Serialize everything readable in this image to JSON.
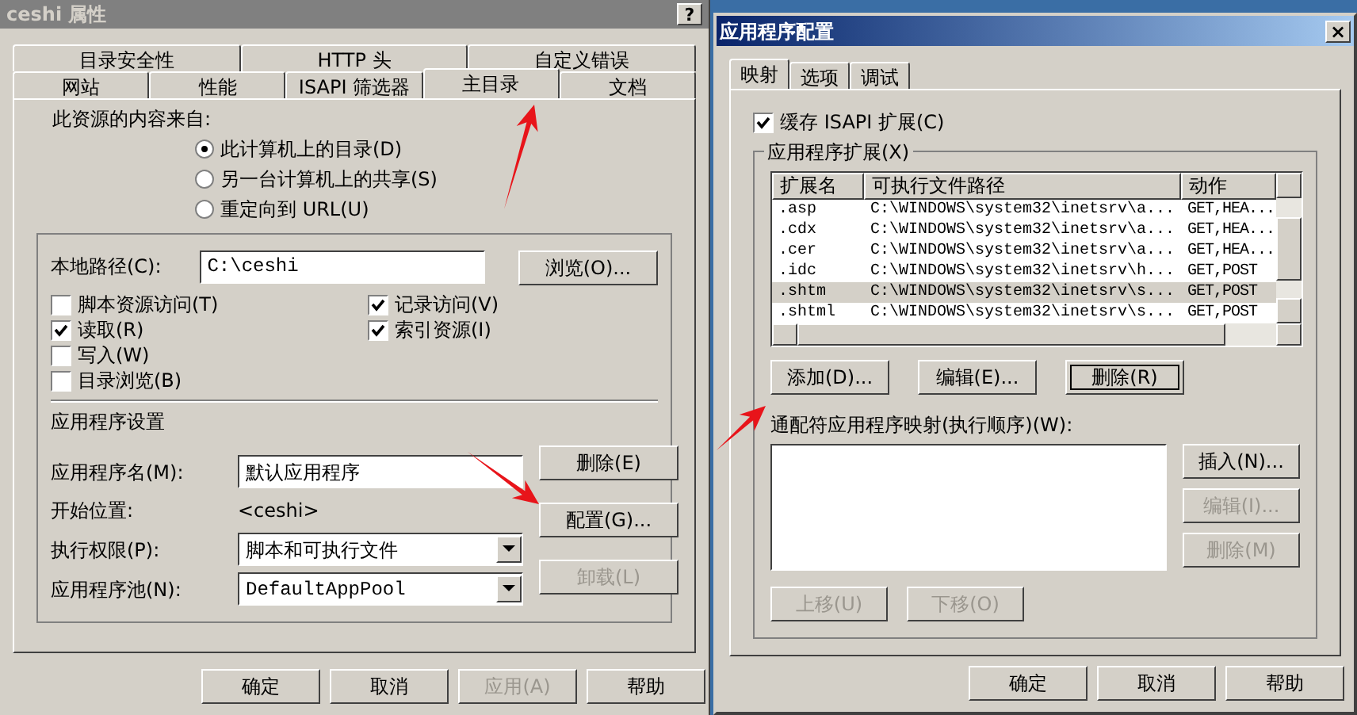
{
  "left_window": {
    "title": "ceshi 属性",
    "help_button": "?",
    "tab_rows": [
      [
        {
          "label": "目录安全性",
          "selected": false
        },
        {
          "label": "HTTP 头",
          "selected": false
        },
        {
          "label": "自定义错误",
          "selected": false
        }
      ],
      [
        {
          "label": "网站",
          "selected": false
        },
        {
          "label": "性能",
          "selected": false
        },
        {
          "label": "ISAPI 筛选器",
          "selected": false
        },
        {
          "label": "主目录",
          "selected": true
        },
        {
          "label": "文档",
          "selected": false
        }
      ]
    ],
    "content_source_label": "此资源的内容来自:",
    "source_options": [
      {
        "label": "此计算机上的目录(D)",
        "selected": true
      },
      {
        "label": "另一台计算机上的共享(S)",
        "selected": false
      },
      {
        "label": "重定向到 URL(U)",
        "selected": false
      }
    ],
    "local_path": {
      "label": "本地路径(C):",
      "value": "C:\\ceshi",
      "button": "浏览(O)..."
    },
    "permissions_left": [
      {
        "label": "脚本资源访问(T)",
        "checked": false
      },
      {
        "label": "读取(R)",
        "checked": true
      },
      {
        "label": "写入(W)",
        "checked": false
      },
      {
        "label": "目录浏览(B)",
        "checked": false
      }
    ],
    "permissions_right": [
      {
        "label": "记录访问(V)",
        "checked": true
      },
      {
        "label": "索引资源(I)",
        "checked": true
      }
    ],
    "app_settings": {
      "title": "应用程序设置",
      "name": {
        "label": "应用程序名(M):",
        "value": "默认应用程序"
      },
      "start": {
        "label": "开始位置:",
        "value": "<ceshi>"
      },
      "exec": {
        "label": "执行权限(P):",
        "value": "脚本和可执行文件"
      },
      "pool": {
        "label": "应用程序池(N):",
        "value": "DefaultAppPool"
      },
      "buttons": [
        {
          "label": "删除(E)",
          "disabled": false
        },
        {
          "label": "配置(G)...",
          "disabled": false
        },
        {
          "label": "卸载(L)",
          "disabled": true
        }
      ]
    },
    "buttons": [
      {
        "label": "确定",
        "disabled": false
      },
      {
        "label": "取消",
        "disabled": false
      },
      {
        "label": "应用(A)",
        "disabled": true
      },
      {
        "label": "帮助",
        "disabled": false
      }
    ]
  },
  "right_window": {
    "title": "应用程序配置",
    "close_button": "×",
    "tabs": [
      {
        "label": "映射",
        "selected": true
      },
      {
        "label": "选项",
        "selected": false
      },
      {
        "label": "调试",
        "selected": false
      }
    ],
    "cache_checkbox": {
      "label": "缓存 ISAPI 扩展(C)",
      "checked": true
    },
    "extensions": {
      "title": "应用程序扩展(X)",
      "columns": [
        "扩展名",
        "可执行文件路径",
        "动作"
      ],
      "rows": [
        {
          "cells": [
            ".asp",
            "C:\\WINDOWS\\system32\\inetsrv\\a...",
            "GET,HEA..."
          ],
          "selected": false
        },
        {
          "cells": [
            ".cdx",
            "C:\\WINDOWS\\system32\\inetsrv\\a...",
            "GET,HEA..."
          ],
          "selected": false
        },
        {
          "cells": [
            ".cer",
            "C:\\WINDOWS\\system32\\inetsrv\\a...",
            "GET,HEA..."
          ],
          "selected": false
        },
        {
          "cells": [
            ".idc",
            "C:\\WINDOWS\\system32\\inetsrv\\h...",
            "GET,POST"
          ],
          "selected": false
        },
        {
          "cells": [
            ".shtm",
            "C:\\WINDOWS\\system32\\inetsrv\\s...",
            "GET,POST"
          ],
          "selected": true
        },
        {
          "cells": [
            ".shtml",
            "C:\\WINDOWS\\system32\\inetsrv\\s...",
            "GET,POST"
          ],
          "selected": false
        }
      ]
    },
    "ext_buttons": [
      {
        "label": "添加(D)...",
        "disabled": false,
        "focused": false
      },
      {
        "label": "编辑(E)...",
        "disabled": false,
        "focused": false
      },
      {
        "label": "删除(R)",
        "disabled": false,
        "focused": true
      }
    ],
    "wildcard_label": "通配符应用程序映射(执行顺序)(W):",
    "wildcard_buttons": [
      {
        "label": "插入(N)...",
        "disabled": false
      },
      {
        "label": "编辑(I)...",
        "disabled": true
      },
      {
        "label": "删除(M)",
        "disabled": true
      }
    ],
    "move_buttons": [
      {
        "label": "上移(U)",
        "disabled": true
      },
      {
        "label": "下移(O)",
        "disabled": true
      }
    ],
    "buttons": [
      {
        "label": "确定",
        "disabled": false
      },
      {
        "label": "取消",
        "disabled": false
      },
      {
        "label": "帮助",
        "disabled": false
      }
    ]
  }
}
